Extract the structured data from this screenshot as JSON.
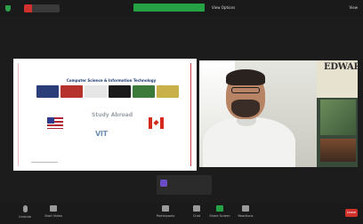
{
  "topbar": {
    "view_options_label": "View Options",
    "view_label": "View"
  },
  "slide": {
    "title": "Computer Science & Information Technology",
    "study_abroad": "Study Abroad",
    "vit_mark": "VIT",
    "flags": [
      "us-flag",
      "canada-flag"
    ]
  },
  "speaker_video": {
    "poster_title": "EDWARDS"
  },
  "chat_toast": {
    "from_label": "",
    "message": ""
  },
  "toolbar": {
    "mute_label": "Unmute",
    "video_label": "Start Video",
    "participants_label": "Participants",
    "participants_count": "",
    "chat_label": "Chat",
    "share_label": "Share Screen",
    "reactions_label": "Reactions",
    "leave_label": "Leave"
  },
  "colors": {
    "accent_green": "#25a244",
    "leave_red": "#d0312d",
    "slide_accent": "#c9404a"
  }
}
